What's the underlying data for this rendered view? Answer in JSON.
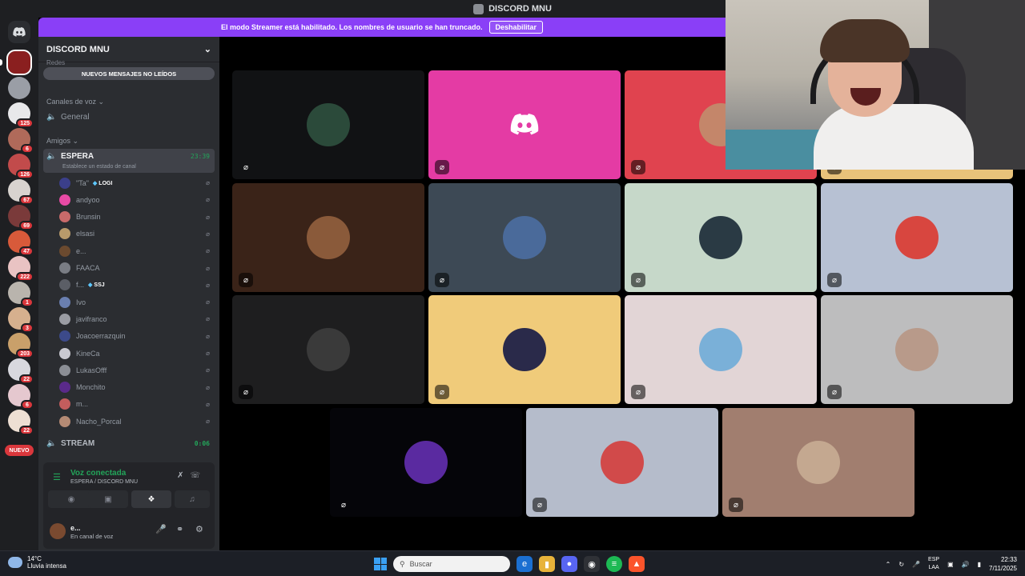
{
  "window": {
    "title": "DISCORD MNU"
  },
  "banner": {
    "text": "El modo Streamer está habilitado. Los nombres de usuario se han truncado.",
    "button": "Deshabilitar"
  },
  "server_rail": {
    "badges": [
      "125",
      "6",
      "126",
      "67",
      "69",
      "47",
      "222",
      "1",
      "3",
      "203",
      "22",
      "6",
      "22"
    ],
    "new_label": "NUEVO"
  },
  "sidebar": {
    "guild_name": "DISCORD MNU",
    "cut_category": "Redes",
    "unread_pill": "NUEVOS MENSAJES NO LEÍDOS",
    "voice_category": "Canales de voz",
    "general_channel": "General",
    "friends_category": "Amigos",
    "active_channel": {
      "name": "ESPERA",
      "timer": "23:39",
      "status": "Establece un estado de canal"
    },
    "members": [
      {
        "name": "\"Ta\"",
        "tag": "LOGI",
        "color": "#3b3f8a"
      },
      {
        "name": "andyoo",
        "tag": "",
        "color": "#e84aa5"
      },
      {
        "name": "Brunsin",
        "tag": "",
        "color": "#c96a6a"
      },
      {
        "name": "elsasi",
        "tag": "",
        "color": "#b89a6b"
      },
      {
        "name": "e...",
        "tag": "",
        "color": "#6b4a2f"
      },
      {
        "name": "FAACA",
        "tag": "",
        "color": "#7a7d84"
      },
      {
        "name": "f...",
        "tag": "SSJ",
        "color": "#5b5e66"
      },
      {
        "name": "Ivo",
        "tag": "",
        "color": "#6a7fb0"
      },
      {
        "name": "javifranco",
        "tag": "",
        "color": "#9a9ca3"
      },
      {
        "name": "Joacoerrazquin",
        "tag": "",
        "color": "#3c4a8a"
      },
      {
        "name": "KineCa",
        "tag": "",
        "color": "#c9c9d1"
      },
      {
        "name": "LukasOfff",
        "tag": "",
        "color": "#8b8e95"
      },
      {
        "name": "Monchito",
        "tag": "",
        "color": "#5a2a8a"
      },
      {
        "name": "m...",
        "tag": "",
        "color": "#c35d5d"
      },
      {
        "name": "Nacho_Porcal",
        "tag": "",
        "color": "#b48a74"
      }
    ],
    "stream_channel": {
      "name": "STREAM",
      "timer": "0:06"
    }
  },
  "voice_panel": {
    "title": "Voz conectada",
    "subtitle": "ESPERA / DISCORD MNU",
    "user_name": "e...",
    "user_status": "En canal de voz"
  },
  "tiles": [
    {
      "bg": "#111214",
      "avatar": "#2b4a3a"
    },
    {
      "bg": "#e43ba4",
      "avatar": "discord-logo"
    },
    {
      "bg": "#e0434f",
      "avatar": "#c4866a"
    },
    {
      "bg": "#e8c27a",
      "avatar": ""
    },
    {
      "bg": "#3a2318",
      "avatar": "#8a5a3a"
    },
    {
      "bg": "#3d4955",
      "avatar": "#4a6a9a"
    },
    {
      "bg": "#c6d8c9",
      "avatar": "#2a3a44"
    },
    {
      "bg": "#b7c1d3",
      "avatar": "#d8463f"
    },
    {
      "bg": "#1e1e1f",
      "avatar": "#3a3a3a"
    },
    {
      "bg": "#f0cb7a",
      "avatar": "#2a2a4a"
    },
    {
      "bg": "#e2d5d6",
      "avatar": "#7ab0d8"
    },
    {
      "bg": "#bdbdbe",
      "avatar": "#b89a8a"
    },
    {
      "bg": "#050509",
      "avatar": "#5a2aa0"
    },
    {
      "bg": "#b5bccb",
      "avatar": "#d14a4a"
    },
    {
      "bg": "#a17e6f",
      "avatar": "#c4a890"
    }
  ],
  "taskbar": {
    "temperature": "14°C",
    "weather": "Lluvia intensa",
    "search_placeholder": "Buscar",
    "lang_top": "ESP",
    "lang_bottom": "LAA",
    "time": "22:33",
    "date": "7/11/2025"
  }
}
